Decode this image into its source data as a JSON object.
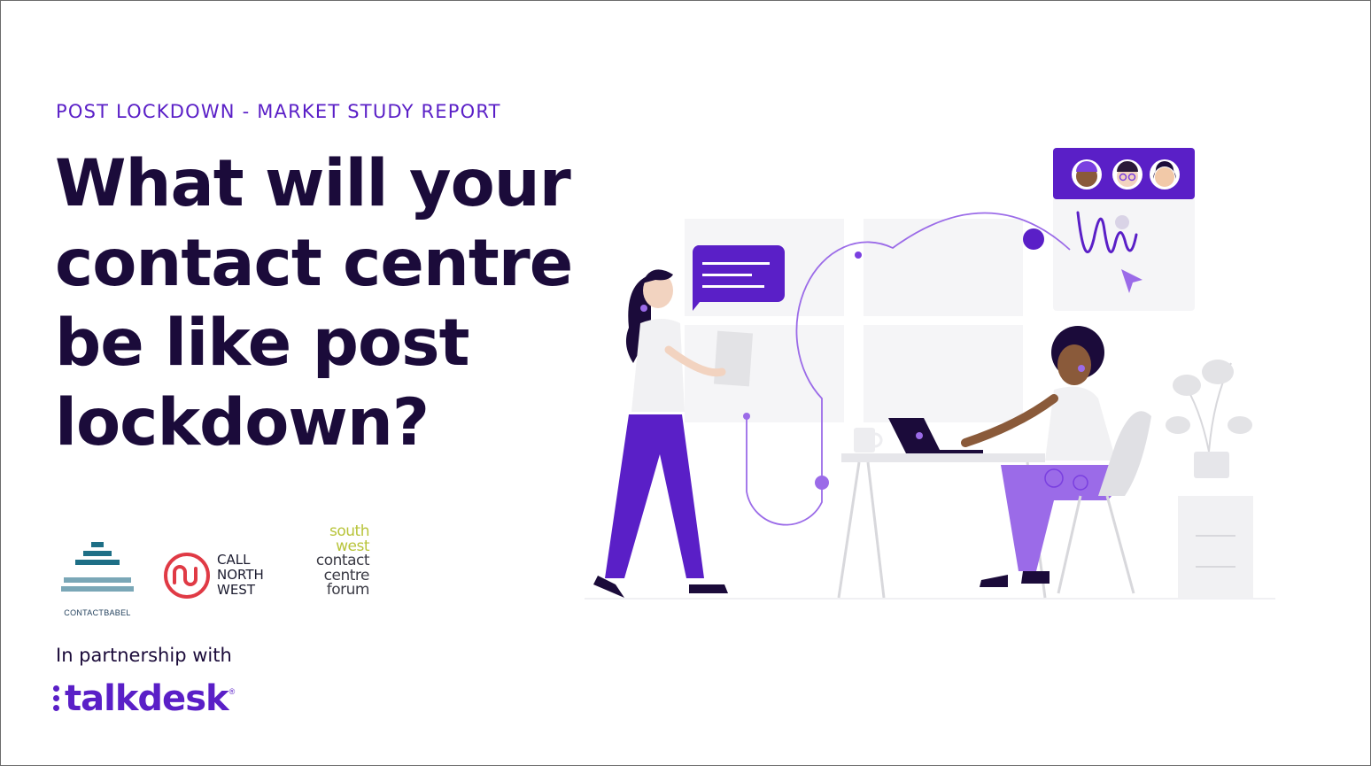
{
  "report": {
    "eyebrow": "POST LOCKDOWN - MARKET STUDY REPORT",
    "headline_lines": [
      "What will your",
      "contact centre",
      "be like post",
      "lockdown?"
    ]
  },
  "logos": {
    "contactbabel": "CONTACTBABEL",
    "callnorthwest": [
      "CALL",
      "NORTH",
      "WEST"
    ],
    "southwest_forum": [
      "south",
      "west",
      "contact",
      "centre",
      "forum"
    ]
  },
  "partnership": {
    "label": "In partnership with",
    "partner_name": "talkdesk",
    "registered_mark": "®"
  },
  "colors": {
    "brand_purple": "#5a1fc7",
    "headline_navy": "#1b0b3a",
    "light_purple": "#9b6be8",
    "skin_dark": "#8a5a3a",
    "panel_gray": "#f3f3f5"
  },
  "illustration": {
    "icons": [
      "chat-bubble-icon",
      "video-call-panel-icon",
      "cursor-icon",
      "laptop-icon",
      "mug-icon",
      "plant-icon"
    ]
  }
}
